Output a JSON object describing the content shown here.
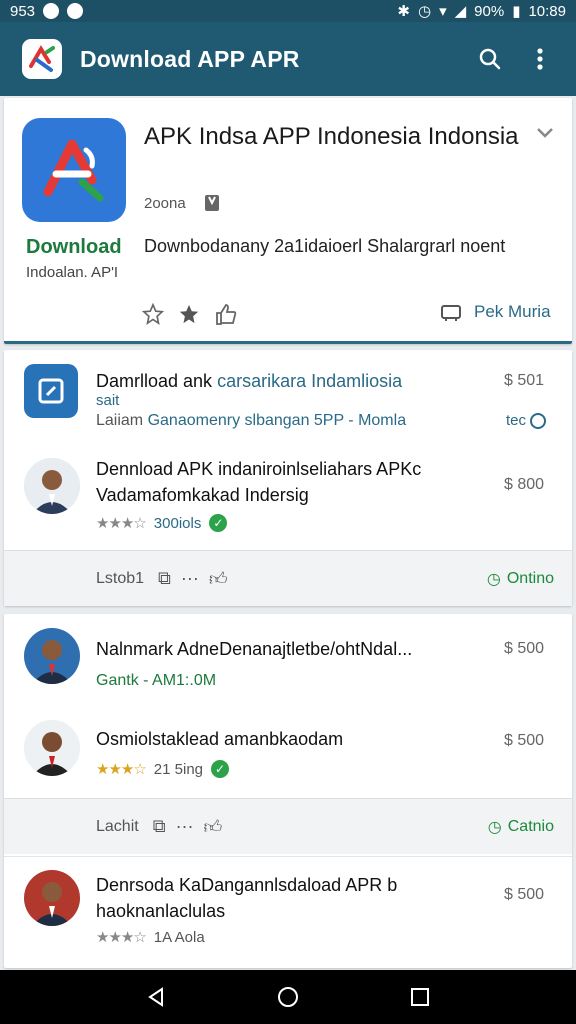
{
  "status_bar": {
    "time_left": "953",
    "battery": "90%",
    "time": "10:89"
  },
  "app_bar": {
    "title": "Download APP APR",
    "search_icon": "search-icon",
    "menu_icon": "more-vert-icon"
  },
  "hero": {
    "title": "APK Indsa APP Indonesia Indonsia",
    "meta_count": "2oona",
    "download_label": "Download",
    "download_sub": "Indoalan. AP'I",
    "description": "Downbodanany 2a1idaioerl Shalargrarl noent",
    "right_action": "Pek Muria"
  },
  "list_a": {
    "item1": {
      "title_plain": "Damrlload ank ",
      "title_link": "carsarikara Indamliosia",
      "title_link2": "sait",
      "sub_plain": "Laiiam ",
      "sub_link": "Ganaomenry slbangan 5PP - Momla",
      "price": "$ 501",
      "side_tag": "tec"
    },
    "item2": {
      "title": "Dennload APK indaniroinlseliahars APKc Vadamafomkakad Indersig",
      "rating_text": "300iols",
      "price": "$ 800"
    },
    "footer": {
      "label": "Lstob1",
      "status": "Ontino"
    }
  },
  "list_b": {
    "item1": {
      "title": "Nalnmark AdneDenanajtletbe/ohtNdal...",
      "sub": "Gantk - AM1:.0M",
      "price": "$ 500"
    },
    "item2": {
      "title": "Osmiolstaklead amanbkaodam",
      "rating_text": "21 5ing",
      "price": "$ 500"
    },
    "footer": {
      "label": "Lachit",
      "status": "Catnio"
    },
    "item3": {
      "title": "Denrsoda KaDangannlsdaload APR b haoknanlaclulas",
      "rating_text": "1A Aola",
      "price": "$ 500"
    }
  },
  "colors": {
    "app_bar": "#1f5a72",
    "accent": "#2a6a86",
    "green": "#1c8a3c"
  }
}
